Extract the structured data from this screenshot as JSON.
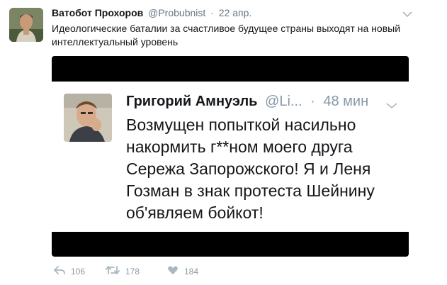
{
  "tweet": {
    "author_name": "Ватобот Прохоров",
    "author_handle": "@Probubnist",
    "separator": "·",
    "timestamp": "22 апр.",
    "text": "Идеологические баталии за счастливое будущее страны выходят на новый интеллектуальный уровень",
    "actions": {
      "reply_count": "106",
      "retweet_count": "178",
      "like_count": "184"
    }
  },
  "embedded_screenshot": {
    "author_name": "Григорий Амнуэль",
    "author_handle": "@Li...",
    "separator": "·",
    "timestamp": "48 мин",
    "text": "Возмущен попыткой насильно накормить г**ном моего друга Сережа Запорожского! Я и Леня Гозман в знак протеста Шейнину об'являем бойкот!"
  },
  "icons": {
    "reply": "reply-icon",
    "retweet": "retweet-icon",
    "like": "heart-icon",
    "caret": "chevron-down-icon"
  },
  "colors": {
    "secondary_text": "#657786",
    "icon_gray": "#8899a6",
    "media_background": "#000000"
  }
}
